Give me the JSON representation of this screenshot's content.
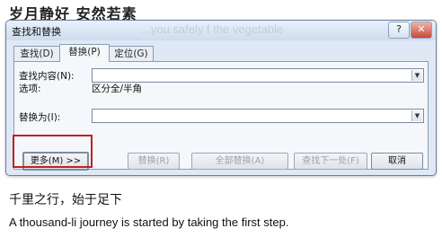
{
  "header_text": "岁月静好 安然若素",
  "window": {
    "title": "查找和替换",
    "help_label": "?",
    "close_label": "✕",
    "background_ghost_text": "...you safely f the vegetable"
  },
  "tabs": [
    {
      "label": "查找(D)"
    },
    {
      "label": "替换(P)"
    },
    {
      "label": "定位(G)"
    }
  ],
  "find": {
    "label": "查找内容(N):",
    "value": ""
  },
  "options": {
    "label": "选项:",
    "value": "区分全/半角"
  },
  "replace": {
    "label": "替换为(I):",
    "value": ""
  },
  "buttons": {
    "more": "更多(M) >>",
    "replace": "替换(R)",
    "replace_all": "全部替换(A)",
    "find_next": "查找下一处(F)",
    "cancel": "取消"
  },
  "footer": {
    "chinese": "千里之行，始于足下",
    "english": "A thousand-li journey is started by taking the first step."
  }
}
